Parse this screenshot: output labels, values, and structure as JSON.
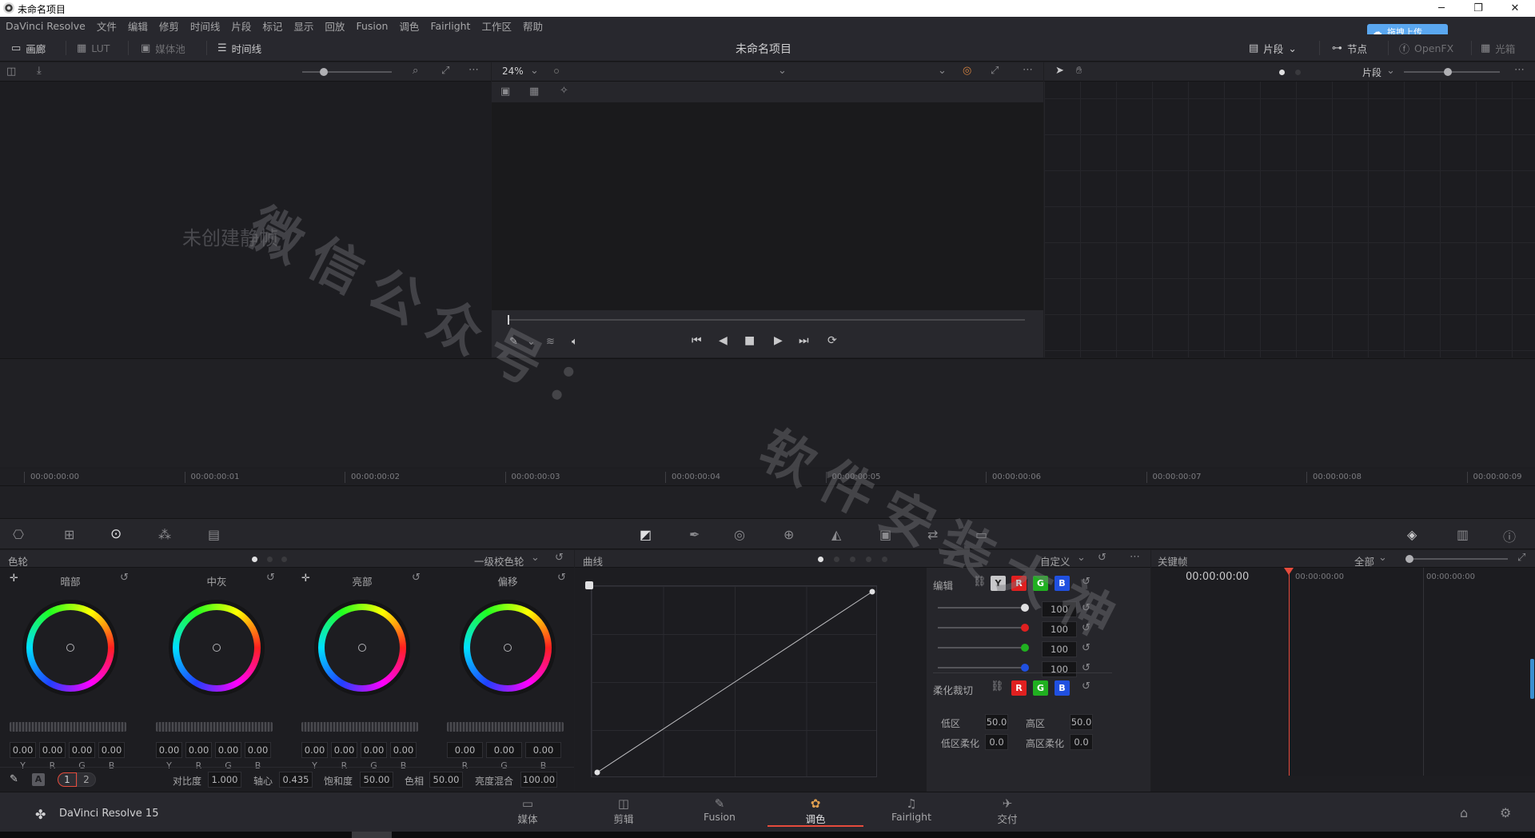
{
  "titlebar": {
    "title": "未命名项目",
    "min": "─",
    "restore": "❐",
    "close": "✕"
  },
  "menu": [
    "DaVinci Resolve",
    "文件",
    "编辑",
    "修剪",
    "时间线",
    "片段",
    "标记",
    "显示",
    "回放",
    "Fusion",
    "调色",
    "Fairlight",
    "工作区",
    "帮助"
  ],
  "upload_label": "拖拽上传",
  "toolbar": {
    "gallery": "画廊",
    "lut": "LUT",
    "media_pool": "媒体池",
    "timeline": "时间线",
    "project_title": "未命名项目",
    "clips": "片段",
    "nodes": "节点",
    "openfx": "OpenFX",
    "lightbox": "光箱"
  },
  "gallery": {
    "empty_text": "未创建静帧"
  },
  "viewer": {
    "zoom": "24%"
  },
  "node_editor": {
    "mode": "片段"
  },
  "timecodes": [
    "00:00:00:00",
    "00:00:00:01",
    "00:00:00:02",
    "00:00:00:03",
    "00:00:00:04",
    "00:00:00:05",
    "00:00:00:06",
    "00:00:00:07",
    "00:00:00:08",
    "00:00:00:09"
  ],
  "wheels": {
    "title": "色轮",
    "mode": "一级校色轮",
    "items": [
      {
        "name": "暗部",
        "values": [
          "0.00",
          "0.00",
          "0.00",
          "0.00"
        ],
        "labels": [
          "Y",
          "R",
          "G",
          "B"
        ]
      },
      {
        "name": "中灰",
        "values": [
          "0.00",
          "0.00",
          "0.00",
          "0.00"
        ],
        "labels": [
          "Y",
          "R",
          "G",
          "B"
        ]
      },
      {
        "name": "亮部",
        "values": [
          "0.00",
          "0.00",
          "0.00",
          "0.00"
        ],
        "labels": [
          "Y",
          "R",
          "G",
          "B"
        ]
      },
      {
        "name": "偏移",
        "values": [
          "0.00",
          "0.00",
          "0.00"
        ],
        "labels": [
          "R",
          "G",
          "B"
        ]
      }
    ],
    "page1": "1",
    "page2": "2",
    "auto": "A",
    "params": [
      {
        "label": "对比度",
        "value": "1.000"
      },
      {
        "label": "轴心",
        "value": "0.435"
      },
      {
        "label": "饱和度",
        "value": "50.00"
      },
      {
        "label": "色相",
        "value": "50.00"
      },
      {
        "label": "亮度混合",
        "value": "100.00"
      }
    ]
  },
  "curves": {
    "title": "曲线",
    "mode": "自定义",
    "edit": "编辑",
    "Y": "Y",
    "R": "R",
    "G": "G",
    "B": "B",
    "intensity": [
      "100",
      "100",
      "100",
      "100"
    ],
    "soft_clip": "柔化裁切",
    "low": "低区",
    "low_val": "50.0",
    "high": "高区",
    "high_val": "50.0",
    "low_soft": "低区柔化",
    "low_soft_val": "0.0",
    "high_soft": "高区柔化",
    "high_soft_val": "0.0"
  },
  "keyframes": {
    "title": "关键帧",
    "mode": "全部",
    "tc_main": "00:00:00:00",
    "tc_a": "00:00:00:00",
    "tc_b": "00:00:00:00"
  },
  "pages": {
    "media": "媒体",
    "cut": "剪辑",
    "fusion": "Fusion",
    "color": "调色",
    "fairlight": "Fairlight",
    "deliver": "交付"
  },
  "brand": "DaVinci Resolve 15",
  "watermark": {
    "line1": "微信公众号：",
    "line2": "软件安装大神"
  },
  "colors": {
    "accent": "#e64b3c",
    "red": "#e02020",
    "green": "#20b020",
    "blue": "#2050e0"
  }
}
